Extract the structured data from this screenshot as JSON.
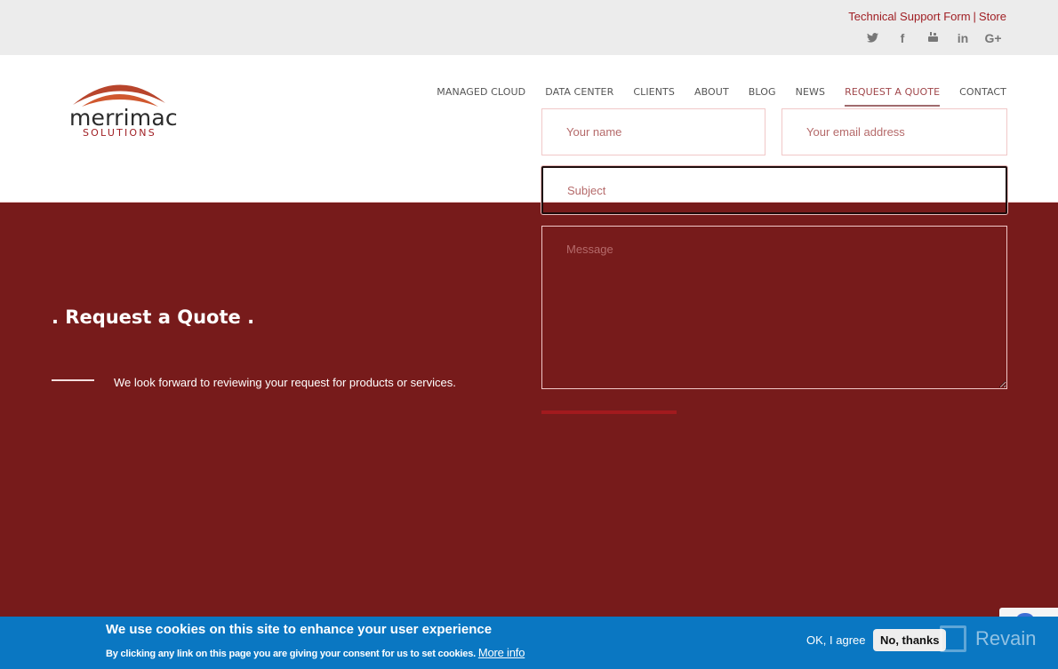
{
  "topbar": {
    "links": [
      "Technical Support Form",
      "Store"
    ],
    "separator": "|",
    "social": [
      {
        "icon": "twitter-icon",
        "glyph": "𝕥"
      },
      {
        "icon": "facebook-icon",
        "glyph": "f"
      },
      {
        "icon": "youtube-icon",
        "glyph": "▶"
      },
      {
        "icon": "linkedin-icon",
        "glyph": "in"
      },
      {
        "icon": "google-plus-icon",
        "glyph": "G+"
      }
    ]
  },
  "logo": {
    "word": "merrimac",
    "sub": "SOLUTIONS"
  },
  "nav": {
    "items": [
      "MANAGED CLOUD",
      "DATA CENTER",
      "CLIENTS",
      "ABOUT",
      "BLOG",
      "NEWS",
      "REQUEST A QUOTE",
      "CONTACT"
    ],
    "active": "REQUEST A QUOTE"
  },
  "main": {
    "title": ". Request a Quote .",
    "intro": "We look forward to reviewing your request for products or services.",
    "form": {
      "name_placeholder": "Your name",
      "email_placeholder": "Your email address",
      "subject_placeholder": "Subject",
      "message_placeholder": "Message"
    }
  },
  "cookie": {
    "title": "We use cookies on this site to enhance your user experience",
    "text": "By clicking any link on this page you are giving your consent for us to set cookies.",
    "more_info": "More info",
    "agree": "OK, I agree",
    "decline": "No, thanks"
  },
  "watermark": "Revain",
  "colors": {
    "brand_red": "#771b1b",
    "accent_red": "#a01f24",
    "cookie_blue": "#0a77c2"
  }
}
